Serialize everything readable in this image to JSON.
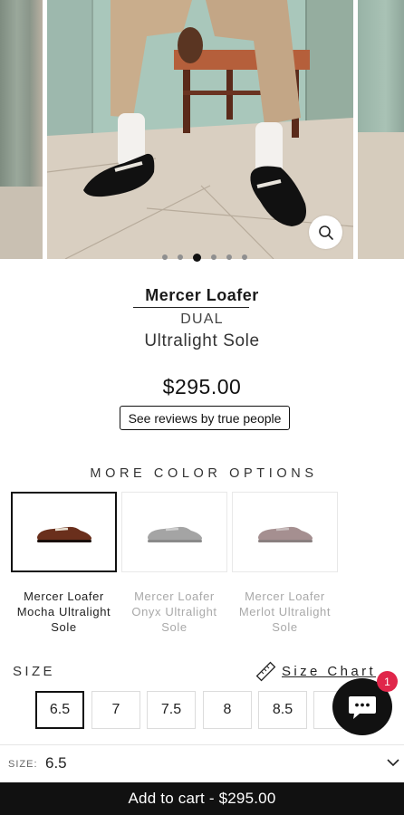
{
  "carousel": {
    "total_slides": 6,
    "active_slide": 2,
    "zoom_icon": "magnifier-icon"
  },
  "product": {
    "title": "Mercer Loafer",
    "subtitle": "DUAL",
    "subtitle2": "Ultralight Sole",
    "price": "$295.00",
    "reviews_label": "See reviews by true people"
  },
  "colors": {
    "heading": "MORE COLOR OPTIONS",
    "options": [
      {
        "line1": "Mercer Loafer",
        "line2": "Mocha Ultralight",
        "line3": "Sole",
        "selected": true,
        "shoe_color": "#6a2f1c"
      },
      {
        "line1": "Mercer Loafer",
        "line2": "Onyx Ultralight",
        "line3": "Sole",
        "selected": false,
        "shoe_color": "#5b5b5b"
      },
      {
        "line1": "Mercer Loafer",
        "line2": "Merlot Ultralight",
        "line3": "Sole",
        "selected": false,
        "shoe_color": "#5c3436"
      }
    ]
  },
  "size": {
    "label": "SIZE",
    "chart_label": "Size Chart",
    "chart_icon": "ruler-icon",
    "options": [
      "6.5",
      "7",
      "7.5",
      "8",
      "8.5",
      ""
    ],
    "selected": "6.5"
  },
  "chat": {
    "icon": "chat-icon",
    "badge": "1",
    "color": "#111111",
    "badge_color": "#e0264a"
  },
  "sticky": {
    "size_label": "SIZE:",
    "size_value": "6.5",
    "add_to_cart": "Add to cart - $295.00"
  }
}
